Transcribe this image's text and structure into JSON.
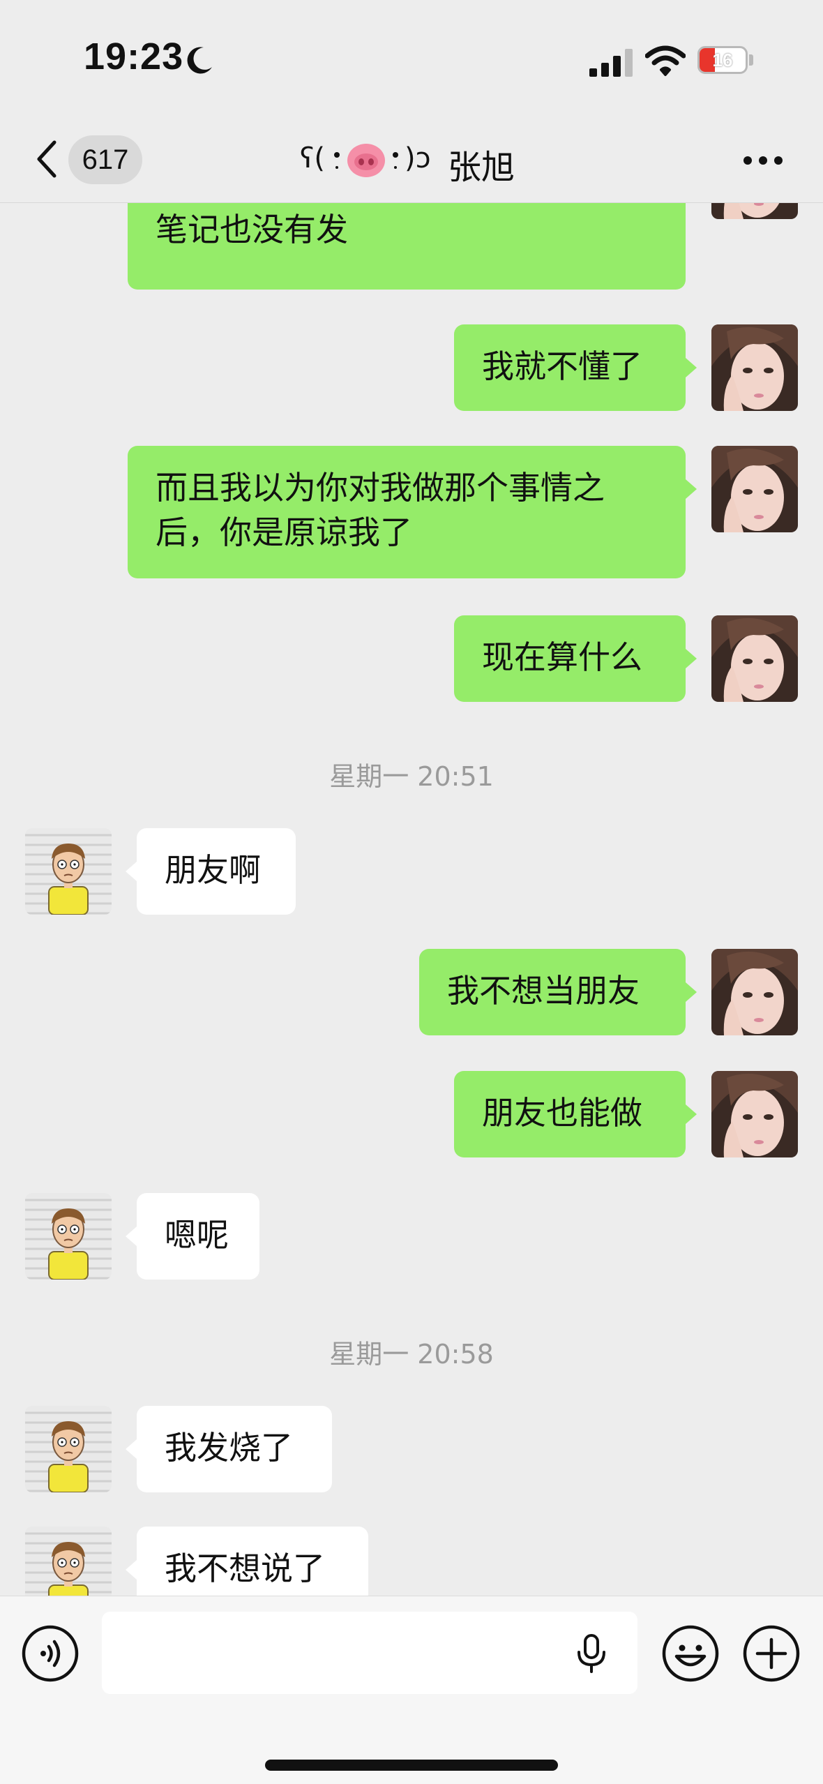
{
  "status_bar": {
    "time": "19:23",
    "battery_level": "16",
    "icons": [
      "moon-icon",
      "cellular-signal-icon",
      "wifi-icon",
      "battery-charging-icon"
    ]
  },
  "nav": {
    "back_icon": "chevron-left-icon",
    "unread_count": "617",
    "title_deco_left": "ʕ(",
    "title_emoji": "pig-nose",
    "title_deco_right": ")ɔ",
    "title_name": "张旭",
    "more_icon": "ellipsis-icon"
  },
  "messages": [
    {
      "side": "sent",
      "text": "我不是已经复好了吗？而且我那\n笔记也没有发"
    },
    {
      "side": "sent",
      "text": "我就不懂了"
    },
    {
      "side": "sent",
      "text": "而且我以为你对我做那个事情之\n后，你是原谅我了"
    },
    {
      "side": "sent",
      "text": "现在算什么"
    },
    {
      "type": "time",
      "text": "星期一 20:51"
    },
    {
      "side": "recv",
      "text": "朋友啊"
    },
    {
      "side": "sent",
      "text": "我不想当朋友"
    },
    {
      "side": "sent",
      "text": "朋友也能做"
    },
    {
      "side": "recv",
      "text": "嗯呢"
    },
    {
      "type": "time",
      "text": "星期一 20:58"
    },
    {
      "side": "recv",
      "text": "我发烧了"
    },
    {
      "side": "recv",
      "text": "我不想说了"
    }
  ],
  "input_bar": {
    "voice_icon": "voice-mode-icon",
    "placeholder": "",
    "mic_icon": "microphone-icon",
    "emoji_icon": "emoji-icon",
    "plus_icon": "plus-icon"
  },
  "colors": {
    "background": "#ededed",
    "sent_bubble": "#95ec69",
    "received_bubble": "#ffffff",
    "timestamp_text": "#9a9a9a",
    "battery_low": "#e8352c"
  }
}
